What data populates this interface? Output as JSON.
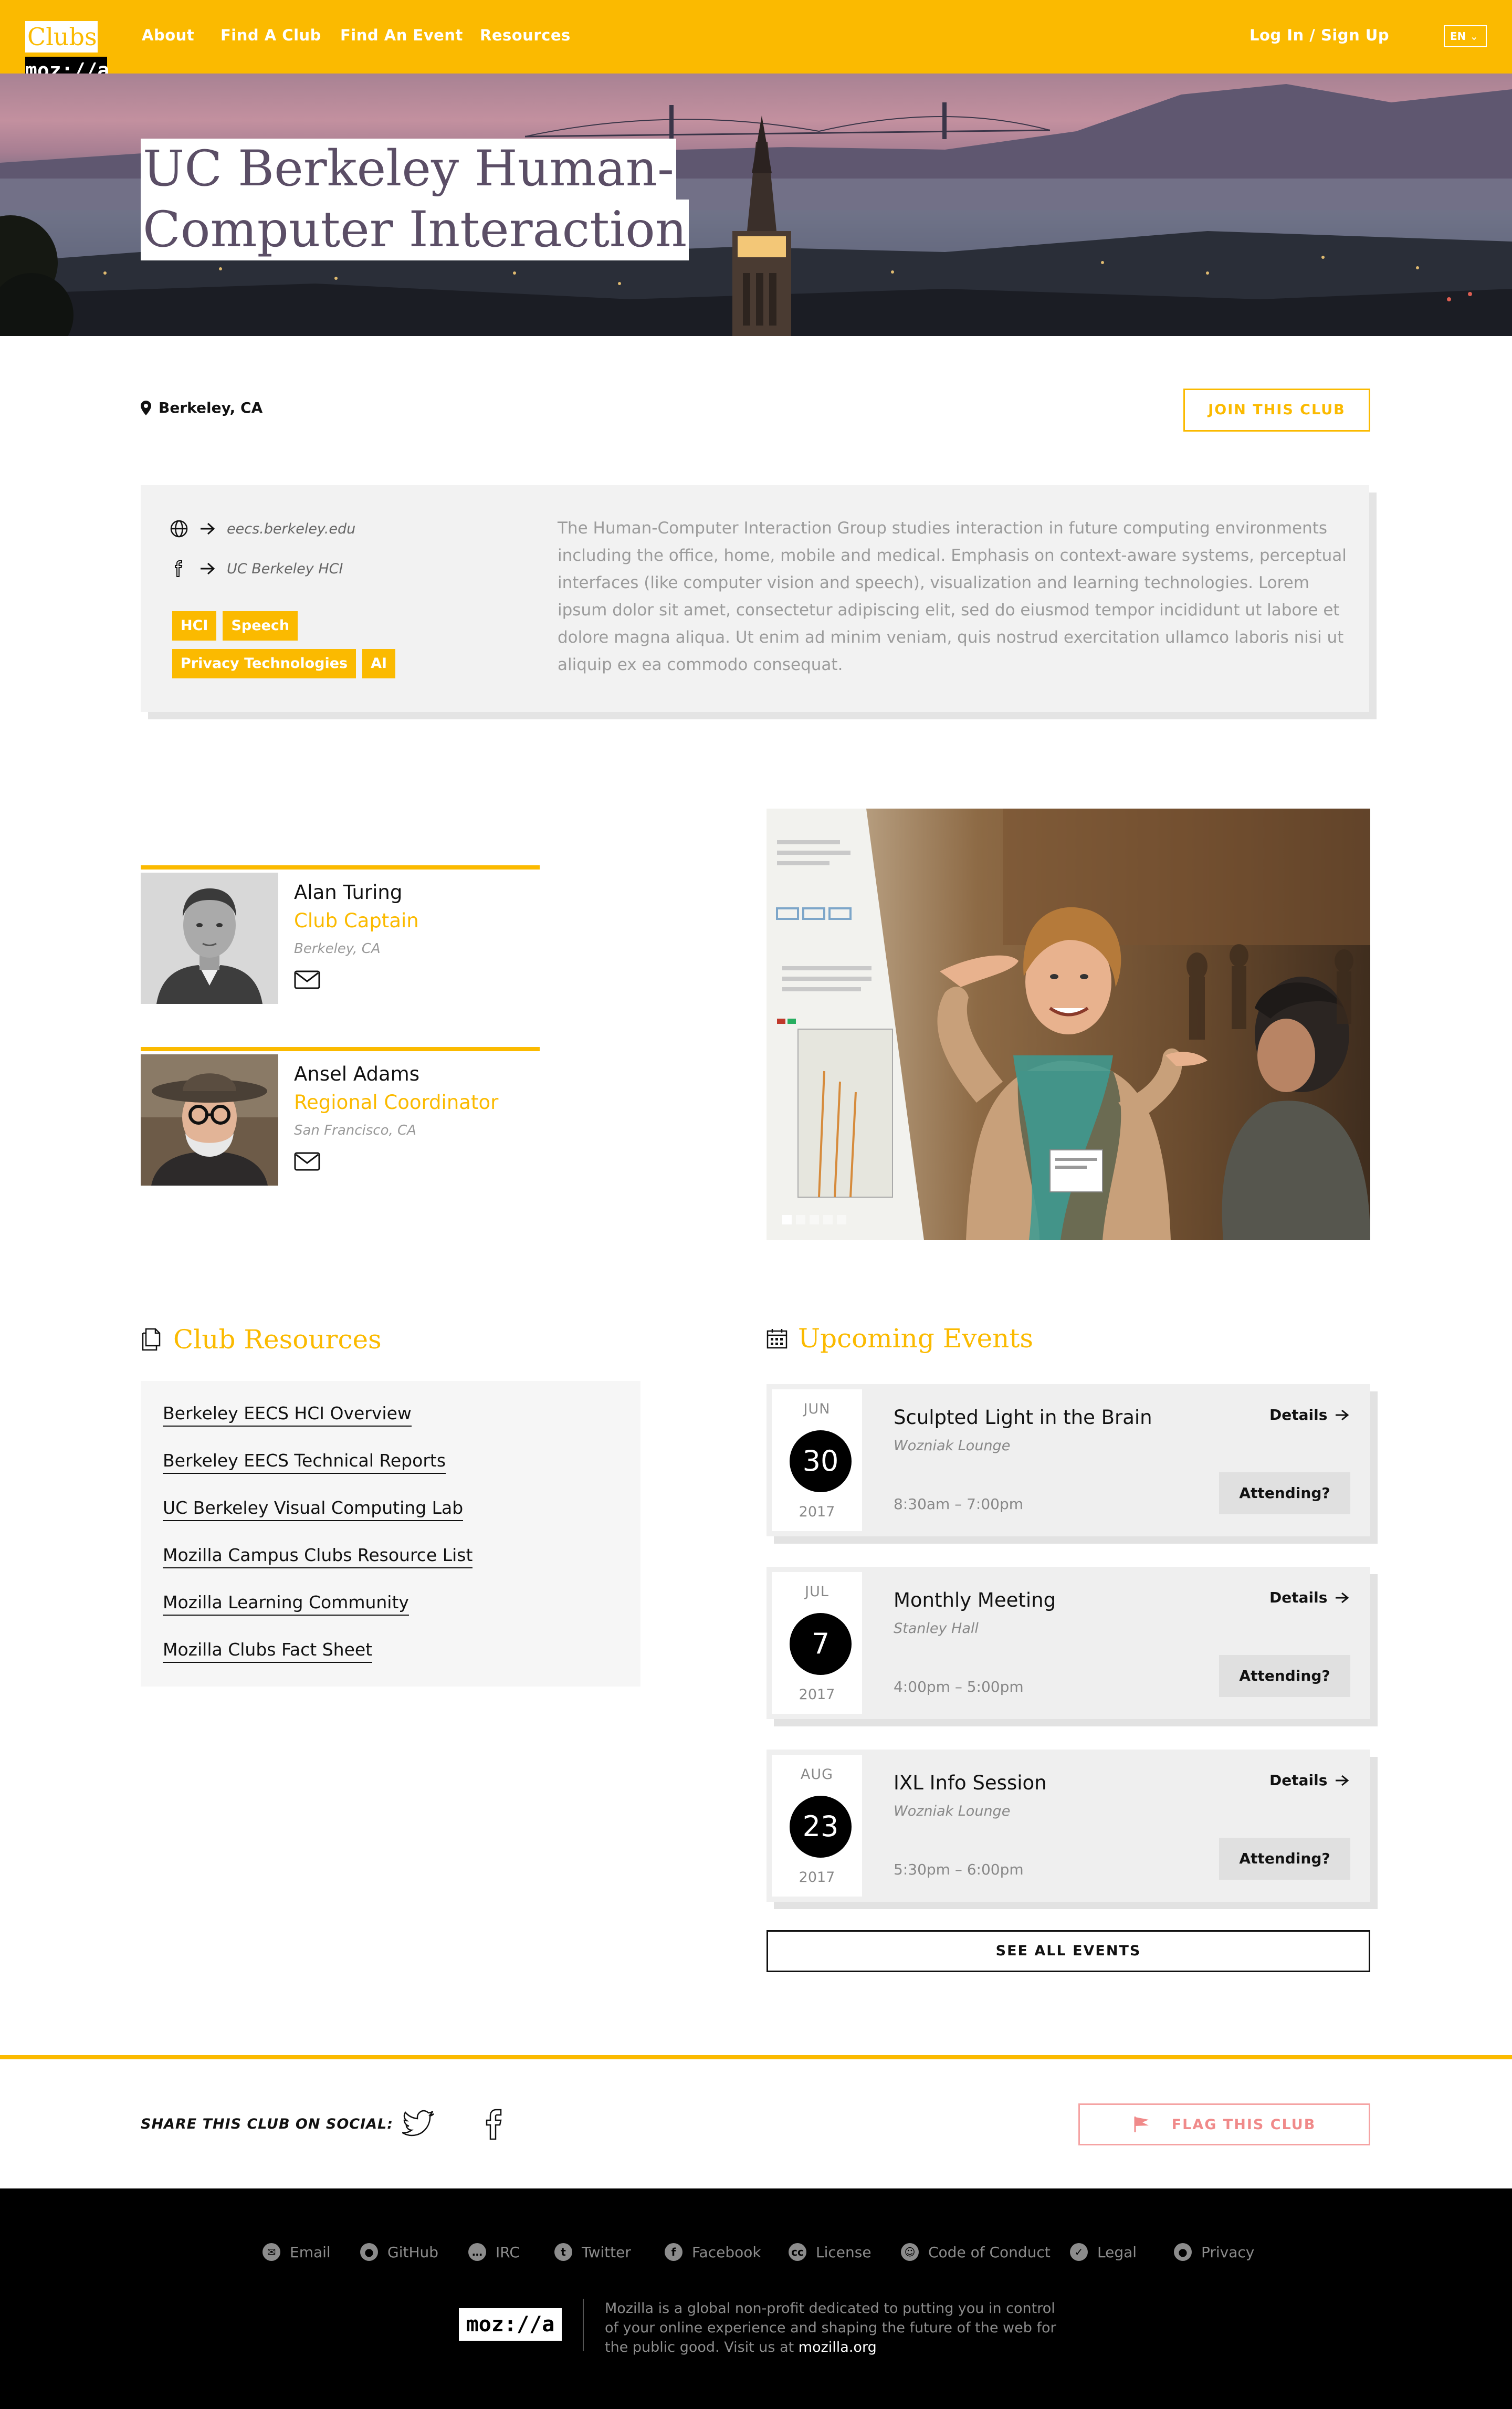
{
  "nav": {
    "logo_clubs": "Clubs",
    "logo_mozilla": "moz://a",
    "links": [
      "About",
      "Find A Club",
      "Find An Event",
      "Resources"
    ],
    "login": "Log In / Sign Up",
    "lang": "EN"
  },
  "hero": {
    "title_line1": "UC Berkeley Human-",
    "title_line2": "Computer Interaction"
  },
  "club": {
    "location": "Berkeley, CA",
    "join_label": "JOIN THIS CLUB",
    "website": "eecs.berkeley.edu",
    "facebook": "UC Berkeley HCI",
    "tags": [
      "HCI",
      "Speech",
      "Privacy Technologies",
      "AI"
    ],
    "description": "The Human-Computer Interaction Group studies interaction in future computing environments including the office, home, mobile and medical. Emphasis on context-aware systems, perceptual interfaces (like computer vision and speech), visualization and learning technologies. Lorem ipsum dolor sit amet, consectetur adipiscing elit, sed do eiusmod tempor incididunt ut labore et dolore magna aliqua. Ut enim ad minim veniam, quis nostrud exercitation ullamco laboris nisi ut aliquip ex ea commodo consequat."
  },
  "leaders": [
    {
      "name": "Alan Turing",
      "role": "Club Captain",
      "location": "Berkeley, CA"
    },
    {
      "name": "Ansel Adams",
      "role": "Regional Coordinator",
      "location": "San Francisco, CA"
    }
  ],
  "carousel": {
    "slides": 5,
    "active": 1
  },
  "resources": {
    "title": "Club Resources",
    "links": [
      "Berkeley EECS HCI Overview",
      "Berkeley EECS Technical Reports",
      "UC Berkeley Visual Computing Lab",
      "Mozilla Campus Clubs Resource List",
      "Mozilla Learning Community",
      "Mozilla Clubs Fact Sheet"
    ]
  },
  "events": {
    "title": "Upcoming Events",
    "details_label": "Details",
    "attend_label": "Attending?",
    "see_all": "SEE ALL EVENTS",
    "items": [
      {
        "month": "JUN",
        "day": "30",
        "year": "2017",
        "title": "Sculpted Light in the Brain",
        "venue": "Wozniak Lounge",
        "time": "8:30am – 7:00pm"
      },
      {
        "month": "JUL",
        "day": "7",
        "year": "2017",
        "title": "Monthly Meeting",
        "venue": "Stanley Hall",
        "time": "4:00pm – 5:00pm"
      },
      {
        "month": "AUG",
        "day": "23",
        "year": "2017",
        "title": "IXL Info Session",
        "venue": "Wozniak Lounge",
        "time": "5:30pm – 6:00pm"
      }
    ]
  },
  "share": {
    "label": "SHARE THIS CLUB ON SOCIAL:",
    "flag_label": "FLAG THIS CLUB"
  },
  "footer": {
    "links": [
      {
        "label": "Email",
        "icon": "email-icon"
      },
      {
        "label": "GitHub",
        "icon": "github-icon"
      },
      {
        "label": "IRC",
        "icon": "irc-icon"
      },
      {
        "label": "Twitter",
        "icon": "twitter-icon"
      },
      {
        "label": "Facebook",
        "icon": "facebook-icon"
      },
      {
        "label": "License",
        "icon": "license-icon"
      },
      {
        "label": "Code of Conduct",
        "icon": "conduct-icon"
      },
      {
        "label": "Legal",
        "icon": "legal-icon"
      },
      {
        "label": "Privacy",
        "icon": "privacy-icon"
      }
    ],
    "logo": "moz://a",
    "text": "Mozilla is a global non-profit dedicated to putting you in control of your online experience and shaping the future of the web for the public good. Visit us at",
    "text_link": "mozilla.org"
  },
  "colors": {
    "accent": "#fbba00",
    "flag": "#f08a8a",
    "footer_bg": "#000000"
  }
}
